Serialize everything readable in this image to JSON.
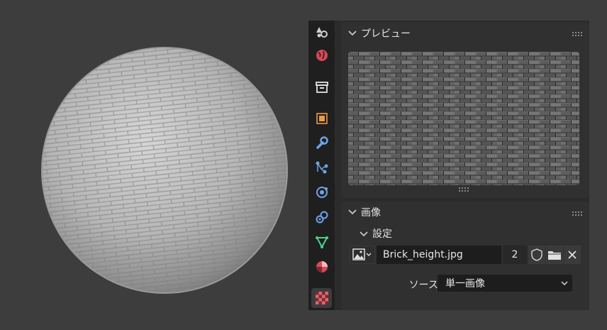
{
  "preview_panel": {
    "title": "プレビュー"
  },
  "image_panel": {
    "title": "画像",
    "settings_subpanel": "設定",
    "image_name": "Brick_height.jpg",
    "user_count": "2",
    "source_label": "ソース",
    "source_value": "単一画像"
  },
  "tabs": [
    {
      "name": "render-tab",
      "icon": "render-icon"
    },
    {
      "name": "world-tab",
      "icon": "world-icon"
    },
    {
      "name": "collection-tab",
      "icon": "collection-icon"
    },
    {
      "name": "object-tab",
      "icon": "object-icon"
    },
    {
      "name": "modifier-tab",
      "icon": "wrench-icon"
    },
    {
      "name": "particles-tab",
      "icon": "particles-icon"
    },
    {
      "name": "physics-tab",
      "icon": "physics-icon"
    },
    {
      "name": "constraints-tab",
      "icon": "constraints-icon"
    },
    {
      "name": "data-tab",
      "icon": "mesh-data-icon"
    },
    {
      "name": "material-tab",
      "icon": "material-icon"
    },
    {
      "name": "texture-tab",
      "icon": "texture-icon",
      "active": true
    }
  ]
}
